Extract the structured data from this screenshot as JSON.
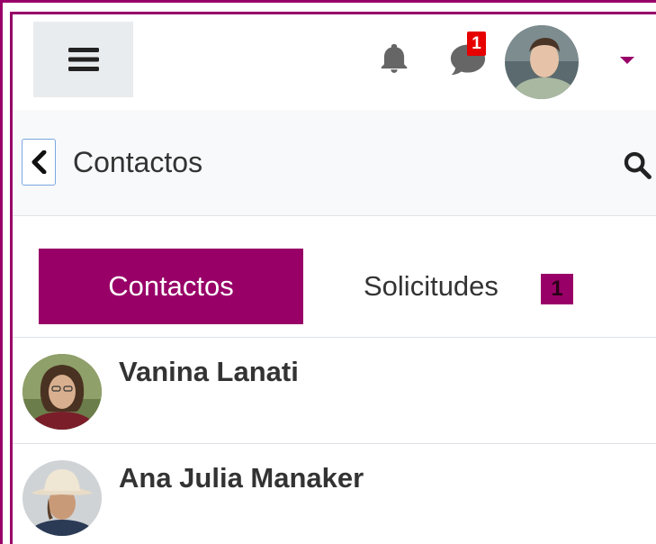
{
  "navbar": {
    "menu_icon": "hamburger-icon",
    "notifications_icon": "bell-icon",
    "messages_icon": "chat-icon",
    "messages_count": "1",
    "user_menu_icon": "caret-down-icon",
    "accent_color": "#980068",
    "badge_color": "#e60000"
  },
  "subheader": {
    "back_icon": "chevron-left-icon",
    "title": "Contactos",
    "search_icon": "search-icon"
  },
  "tabs": {
    "items": [
      {
        "label": "Contactos",
        "active": true
      },
      {
        "label": "Solicitudes",
        "active": false,
        "badge": "1"
      }
    ]
  },
  "contacts": [
    {
      "name": "Vanina Lanati"
    },
    {
      "name": "Ana Julia Manaker"
    }
  ]
}
